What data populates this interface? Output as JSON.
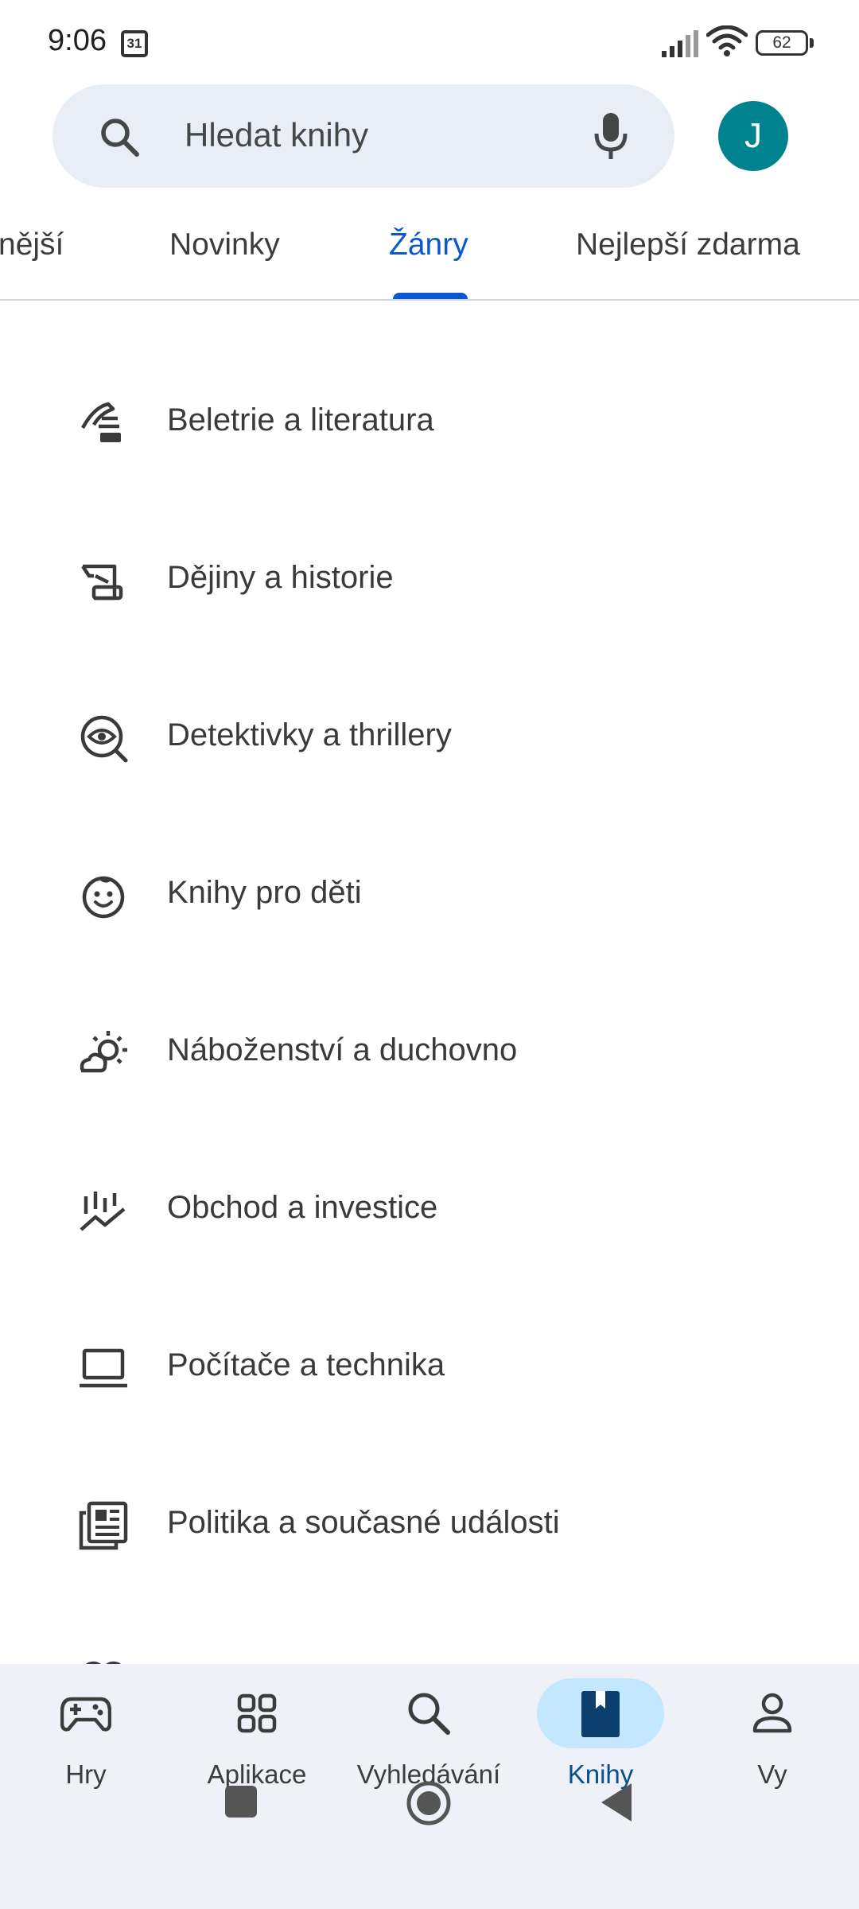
{
  "status_bar": {
    "time": "9:06",
    "calendar_day": "31",
    "battery": "62",
    "icons": [
      "calendar-icon",
      "signal-icon",
      "wifi-icon",
      "battery-icon"
    ]
  },
  "search": {
    "placeholder": "Hledat knihy",
    "icon": "search-icon",
    "mic_icon": "mic-icon"
  },
  "account": {
    "avatar_letter": "J",
    "avatar_color": "#00838f"
  },
  "tabs": [
    {
      "label": "nější",
      "active": false
    },
    {
      "label": "Novinky",
      "active": false
    },
    {
      "label": "Žánry",
      "active": true
    },
    {
      "label": "Nejlepší zdarma",
      "active": false
    }
  ],
  "genres": [
    {
      "label": "Beletrie a literatura",
      "icon": "quill-icon"
    },
    {
      "label": "Dějiny a historie",
      "icon": "scroll-icon"
    },
    {
      "label": "Detektivky a thrillery",
      "icon": "eye-search-icon"
    },
    {
      "label": "Knihy pro děti",
      "icon": "child-face-icon"
    },
    {
      "label": "Náboženství a duchovno",
      "icon": "sun-cloud-icon"
    },
    {
      "label": "Obchod a investice",
      "icon": "stock-chart-icon"
    },
    {
      "label": "Počítače a technika",
      "icon": "laptop-icon"
    },
    {
      "label": "Politika a současné události",
      "icon": "newspaper-icon"
    }
  ],
  "bottom_nav": [
    {
      "label": "Hry",
      "icon": "gamepad-icon",
      "active": false
    },
    {
      "label": "Aplikace",
      "icon": "apps-grid-icon",
      "active": false
    },
    {
      "label": "Vyhledávání",
      "icon": "search-icon",
      "active": false
    },
    {
      "label": "Knihy",
      "icon": "book-icon",
      "active": true
    },
    {
      "label": "Vy",
      "icon": "person-icon",
      "active": false
    }
  ],
  "colors": {
    "accent": "#0b57d0",
    "active_pill": "#c2e7ff",
    "nav_background": "#eef1f7",
    "search_background": "#e9eef6"
  }
}
